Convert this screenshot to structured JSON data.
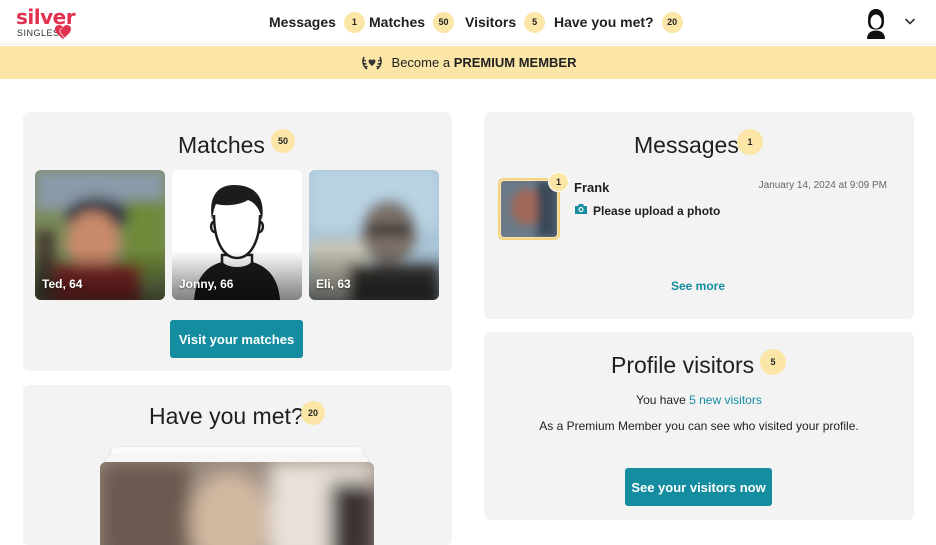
{
  "logo": {
    "name": "silver",
    "sub": "SINGLES"
  },
  "nav": {
    "items": [
      {
        "label": "Messages",
        "count": "1"
      },
      {
        "label": "Matches",
        "count": "50"
      },
      {
        "label": "Visitors",
        "count": "5"
      },
      {
        "label": "Have you met?",
        "count": "20"
      }
    ]
  },
  "banner": {
    "prefix": "Become a ",
    "emphasis": "PREMIUM MEMBER"
  },
  "matches": {
    "title": "Matches",
    "count": "50",
    "people": [
      {
        "label": "Ted, 64"
      },
      {
        "label": "Jonny, 66"
      },
      {
        "label": "Eli, 63"
      }
    ],
    "button": "Visit your matches"
  },
  "have_you_met": {
    "title": "Have you met?",
    "count": "20"
  },
  "messages": {
    "title": "Messages",
    "count": "1",
    "items": [
      {
        "name": "Frank",
        "date": "January 14, 2024 at 9:09 PM",
        "preview": "Please upload a photo",
        "badge": "1"
      }
    ],
    "see_more": "See more"
  },
  "visitors": {
    "title": "Profile visitors",
    "count": "5",
    "line1_prefix": "You have ",
    "line1_link": "5 new visitors",
    "line2": "As a Premium Member you can see who visited your profile.",
    "button": "See your visitors now"
  },
  "colors": {
    "brand": "#e0314f",
    "accent": "#138d9f",
    "badge": "#fbe6a7",
    "card": "#f2f3f2"
  }
}
